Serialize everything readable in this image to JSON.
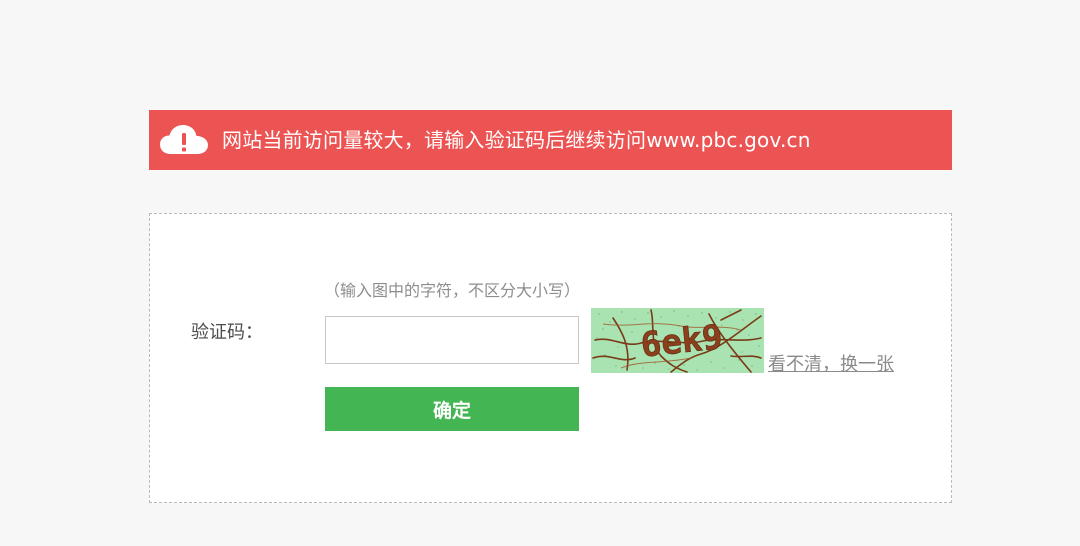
{
  "banner": {
    "icon": "cloud-warning-icon",
    "message": "网站当前访问量较大，请输入验证码后继续访问www.pbc.gov.cn",
    "color": "#ec5453"
  },
  "form": {
    "hint": "（输入图中的字符，不区分大小写）",
    "label": "验证码：",
    "input_value": "",
    "captcha_text": "6ek9",
    "captcha_bg_color": "#a9e3b1",
    "refresh_link": "看不清，换一张",
    "submit_label": "确定",
    "submit_color": "#43b553"
  }
}
